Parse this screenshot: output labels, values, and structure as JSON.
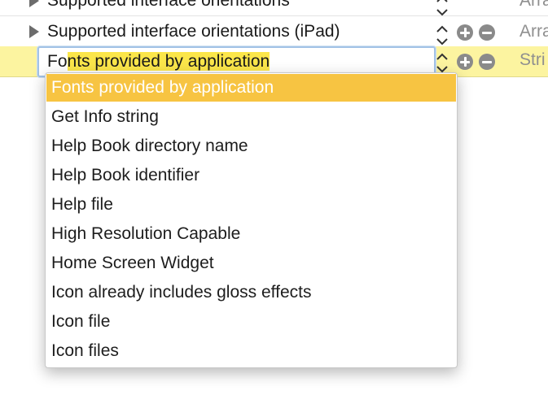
{
  "rows": [
    {
      "key": "Supported interface orientations",
      "type": "Arra"
    },
    {
      "key": "Supported interface orientations (iPad)",
      "type": "Arra"
    }
  ],
  "edit_row": {
    "typed": "Fo",
    "autocomplete": "nts provided by application",
    "type": "Stri"
  },
  "popup": {
    "items": [
      "Fonts provided by application",
      "Get Info string",
      "Help Book directory name",
      "Help Book identifier",
      "Help file",
      "High Resolution Capable",
      "Home Screen Widget",
      "Icon already includes gloss effects",
      "Icon file",
      "Icon files"
    ],
    "selected_index": 0
  },
  "colors": {
    "row_highlight": "#fcf4a0",
    "selection": "#f7c442",
    "autocomplete_highlight": "#fbe64a",
    "focus_ring": "#a3c3e6"
  },
  "icons": {
    "disclosure": "disclosure-triangle-icon",
    "stepper": "up-down-chevron-icon",
    "add": "plus-circle-icon",
    "remove": "minus-circle-icon"
  }
}
